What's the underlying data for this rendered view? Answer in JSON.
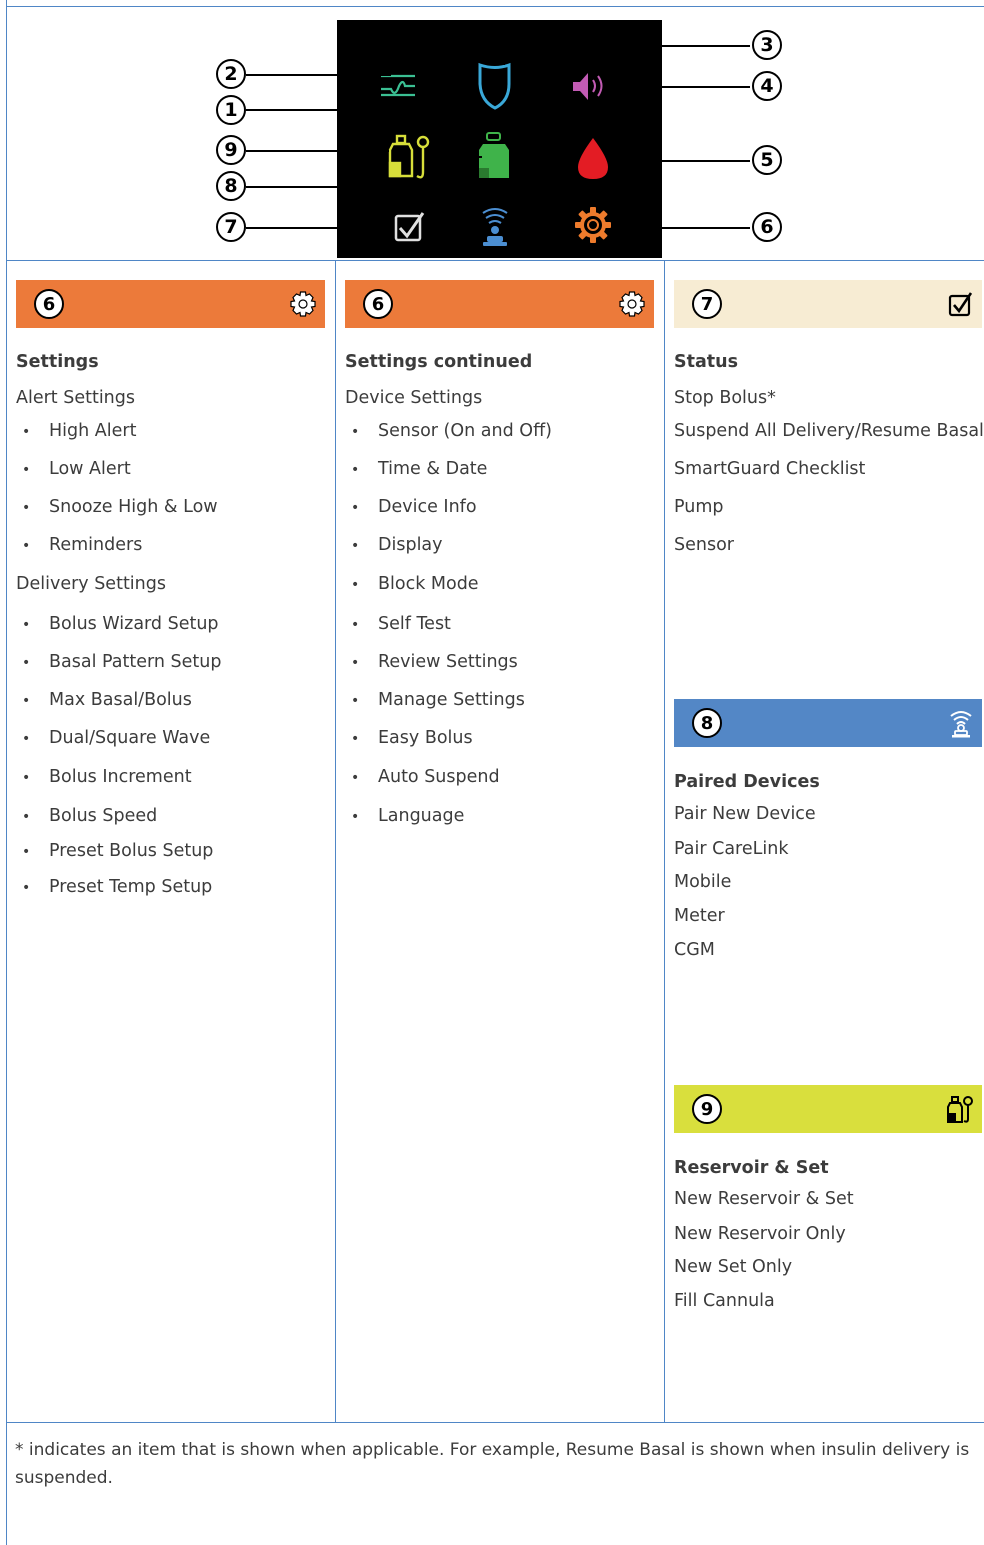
{
  "diagram": {
    "callouts": [
      "1",
      "2",
      "3",
      "4",
      "5",
      "6",
      "7",
      "8",
      "9"
    ],
    "icons": {
      "1": "reservoir-icon",
      "2": "sensor-graph-icon",
      "3": "smartguard-shield-icon",
      "4": "audio-icon",
      "5": "blood-drop-icon",
      "6": "gear-icon",
      "7": "checkmark-icon",
      "8": "paired-device-icon",
      "9": "reservoir-set-icon"
    },
    "colors": {
      "orange": "#ec7a3a",
      "beige": "#f7ecd3",
      "blue": "#5387c6",
      "lime": "#d9df3d"
    }
  },
  "col1": {
    "number": "6",
    "icon": "gear-icon",
    "title": "Settings",
    "groups": [
      {
        "label": "Alert Settings",
        "items": [
          "High Alert",
          "Low Alert",
          "Snooze High & Low",
          "Reminders"
        ]
      },
      {
        "label": "Delivery Settings",
        "items": [
          "Bolus Wizard Setup",
          "Basal Pattern Setup",
          "Max Basal/Bolus",
          "Dual/Square Wave",
          "Bolus Increment",
          "Bolus Speed",
          "Preset Bolus Setup",
          "Preset Temp Setup"
        ]
      }
    ]
  },
  "col2": {
    "number": "6",
    "icon": "gear-icon",
    "title": "Settings continued",
    "groups": [
      {
        "label": "Device Settings",
        "items": [
          "Sensor (On and Off)",
          "Time & Date",
          "Device Info",
          "Display",
          "Block Mode",
          "Self Test",
          "Review Settings",
          "Manage Settings",
          "Easy Bolus",
          "Auto Suspend",
          "Language"
        ]
      }
    ]
  },
  "col3": {
    "status": {
      "number": "7",
      "icon": "checkmark-icon",
      "title": "Status",
      "items": [
        "Stop Bolus*",
        "Suspend All Delivery/Resume Basal*",
        "SmartGuard Checklist",
        "Pump",
        "Sensor"
      ]
    },
    "paired": {
      "number": "8",
      "icon": "paired-device-icon",
      "title": "Paired Devices",
      "items": [
        "Pair New Device",
        "Pair CareLink",
        "Mobile",
        "Meter",
        "CGM"
      ]
    },
    "reservoir": {
      "number": "9",
      "icon": "reservoir-set-icon",
      "title": "Reservoir & Set",
      "items": [
        "New Reservoir & Set",
        "New Reservoir Only",
        "New Set Only",
        "Fill Cannula"
      ]
    }
  },
  "footnote": "* indicates an item that is shown when applicable. For example, Resume Basal is shown when insulin delivery is suspended."
}
